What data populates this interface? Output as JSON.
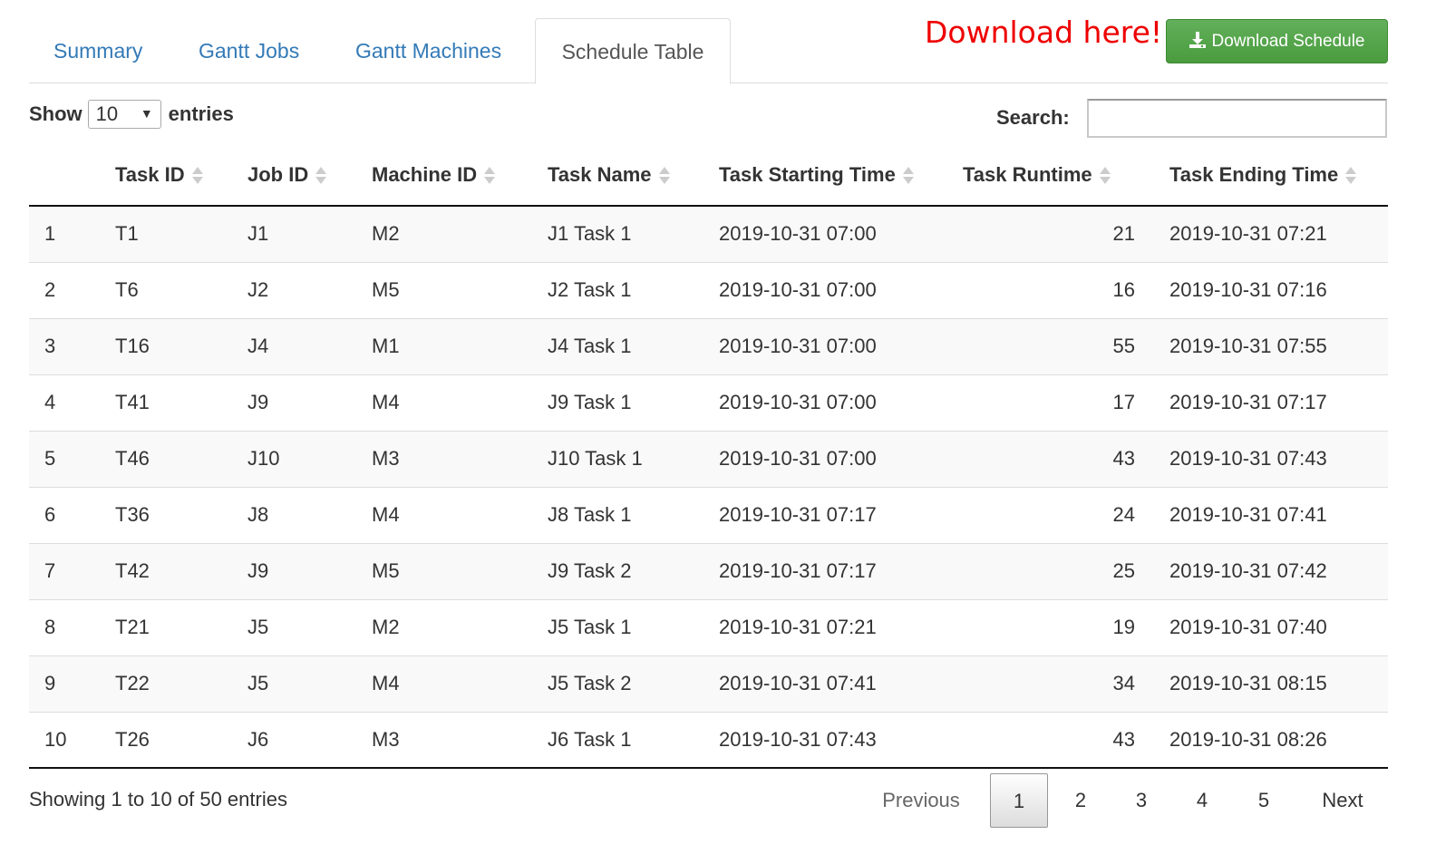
{
  "tabs": [
    {
      "label": "Summary"
    },
    {
      "label": "Gantt Jobs"
    },
    {
      "label": "Gantt Machines"
    },
    {
      "label": "Schedule Table"
    }
  ],
  "annotation": "Download here!",
  "download_button": {
    "label": "Download Schedule",
    "icon": "download-icon",
    "color": "#5cb85c"
  },
  "length_menu": {
    "show": "Show",
    "value": "10",
    "entries": "entries"
  },
  "search": {
    "label": "Search:",
    "value": ""
  },
  "table": {
    "columns": [
      "",
      "Task ID",
      "Job ID",
      "Machine ID",
      "Task Name",
      "Task Starting Time",
      "Task Runtime",
      "Task Ending Time"
    ],
    "rows": [
      [
        "1",
        "T1",
        "J1",
        "M2",
        "J1 Task 1",
        "2019-10-31 07:00",
        "21",
        "2019-10-31 07:21"
      ],
      [
        "2",
        "T6",
        "J2",
        "M5",
        "J2 Task 1",
        "2019-10-31 07:00",
        "16",
        "2019-10-31 07:16"
      ],
      [
        "3",
        "T16",
        "J4",
        "M1",
        "J4 Task 1",
        "2019-10-31 07:00",
        "55",
        "2019-10-31 07:55"
      ],
      [
        "4",
        "T41",
        "J9",
        "M4",
        "J9 Task 1",
        "2019-10-31 07:00",
        "17",
        "2019-10-31 07:17"
      ],
      [
        "5",
        "T46",
        "J10",
        "M3",
        "J10 Task 1",
        "2019-10-31 07:00",
        "43",
        "2019-10-31 07:43"
      ],
      [
        "6",
        "T36",
        "J8",
        "M4",
        "J8 Task 1",
        "2019-10-31 07:17",
        "24",
        "2019-10-31 07:41"
      ],
      [
        "7",
        "T42",
        "J9",
        "M5",
        "J9 Task 2",
        "2019-10-31 07:17",
        "25",
        "2019-10-31 07:42"
      ],
      [
        "8",
        "T21",
        "J5",
        "M2",
        "J5 Task 1",
        "2019-10-31 07:21",
        "19",
        "2019-10-31 07:40"
      ],
      [
        "9",
        "T22",
        "J5",
        "M4",
        "J5 Task 2",
        "2019-10-31 07:41",
        "34",
        "2019-10-31 08:15"
      ],
      [
        "10",
        "T26",
        "J6",
        "M3",
        "J6 Task 1",
        "2019-10-31 07:43",
        "43",
        "2019-10-31 08:26"
      ]
    ]
  },
  "footer": {
    "info": "Showing 1 to 10 of 50 entries",
    "previous": "Previous",
    "pages": [
      "1",
      "2",
      "3",
      "4",
      "5"
    ],
    "current_page": "1",
    "next": "Next"
  }
}
